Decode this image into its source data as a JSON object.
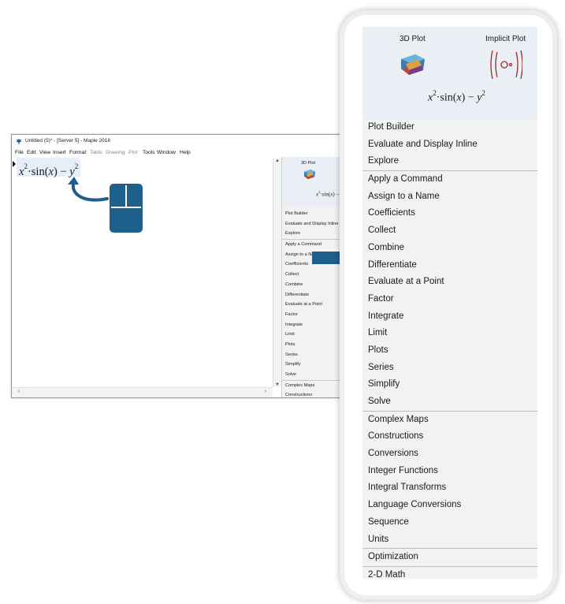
{
  "window": {
    "title": "Untitled (5)* - [Server 5] - Maple 2018",
    "minimize_glyph": "–",
    "menus": [
      {
        "label": "File",
        "enabled": true
      },
      {
        "label": "Edit",
        "enabled": true
      },
      {
        "label": "View",
        "enabled": true
      },
      {
        "label": "Insert",
        "enabled": true
      },
      {
        "label": "Format",
        "enabled": true
      },
      {
        "label": "Table",
        "enabled": false
      },
      {
        "label": "Drawing",
        "enabled": false
      },
      {
        "label": "Plot",
        "enabled": false
      },
      {
        "label": "Tools",
        "enabled": true
      },
      {
        "label": "Window",
        "enabled": true
      },
      {
        "label": "Help",
        "enabled": true
      }
    ]
  },
  "expression": {
    "var_x": "x",
    "exp_2": "2",
    "dot_sin": "·sin",
    "open_paren": "(",
    "arg_x": "x",
    "close_paren": ")",
    "minus": "−",
    "var_y": "y"
  },
  "context_panel": {
    "plot_3d_label": "3D Plot",
    "implicit_plot_label": "Implicit Plot",
    "small_items": [
      {
        "label": "Plot Builder",
        "sep": false
      },
      {
        "label": "Evaluate and Display Inline",
        "sep": false
      },
      {
        "label": "Explore",
        "sep": false
      },
      {
        "label": "Apply a Command",
        "sep": true
      },
      {
        "label": "Assign to a Name",
        "sep": false
      },
      {
        "label": "Coefficients",
        "sep": false
      },
      {
        "label": "Collect",
        "sep": false
      },
      {
        "label": "Combine",
        "sep": false
      },
      {
        "label": "Differentiate",
        "sep": false
      },
      {
        "label": "Evaluate at a Point",
        "sep": false
      },
      {
        "label": "Factor",
        "sep": false
      },
      {
        "label": "Integrate",
        "sep": false
      },
      {
        "label": "Limit",
        "sep": false
      },
      {
        "label": "Plots",
        "sep": false
      },
      {
        "label": "Series",
        "sep": false
      },
      {
        "label": "Simplify",
        "sep": false
      },
      {
        "label": "Solve",
        "sep": false
      },
      {
        "label": "Complex Maps",
        "sep": true
      },
      {
        "label": "Constructions",
        "sep": false
      }
    ],
    "items": [
      {
        "label": "Plot Builder",
        "sep": false
      },
      {
        "label": "Evaluate and Display Inline",
        "sep": false
      },
      {
        "label": "Explore",
        "sep": false
      },
      {
        "label": "Apply a Command",
        "sep": true
      },
      {
        "label": "Assign to a Name",
        "sep": false
      },
      {
        "label": "Coefficients",
        "sep": false
      },
      {
        "label": "Collect",
        "sep": false
      },
      {
        "label": "Combine",
        "sep": false
      },
      {
        "label": "Differentiate",
        "sep": false
      },
      {
        "label": "Evaluate at a Point",
        "sep": false
      },
      {
        "label": "Factor",
        "sep": false
      },
      {
        "label": "Integrate",
        "sep": false
      },
      {
        "label": "Limit",
        "sep": false
      },
      {
        "label": "Plots",
        "sep": false
      },
      {
        "label": "Series",
        "sep": false
      },
      {
        "label": "Simplify",
        "sep": false
      },
      {
        "label": "Solve",
        "sep": false
      },
      {
        "label": "Complex Maps",
        "sep": true
      },
      {
        "label": "Constructions",
        "sep": false
      },
      {
        "label": "Conversions",
        "sep": false
      },
      {
        "label": "Integer Functions",
        "sep": false
      },
      {
        "label": "Integral Transforms",
        "sep": false
      },
      {
        "label": "Language Conversions",
        "sep": false
      },
      {
        "label": "Sequence",
        "sep": false
      },
      {
        "label": "Units",
        "sep": false
      },
      {
        "label": "Optimization",
        "sep": true
      },
      {
        "label": "2-D Math",
        "sep": true
      }
    ]
  },
  "colors": {
    "accent_blue": "#1f5f8b",
    "selection_bg": "#e6eef9",
    "panel_bg": "#f2f2f2",
    "header_bg": "#e9eff5"
  },
  "icons": [
    "maple-leaf-icon",
    "mouse-icon",
    "curved-arrow-icon",
    "right-arrow-icon",
    "plot-3d-thumbnail",
    "implicit-plot-thumbnail"
  ]
}
